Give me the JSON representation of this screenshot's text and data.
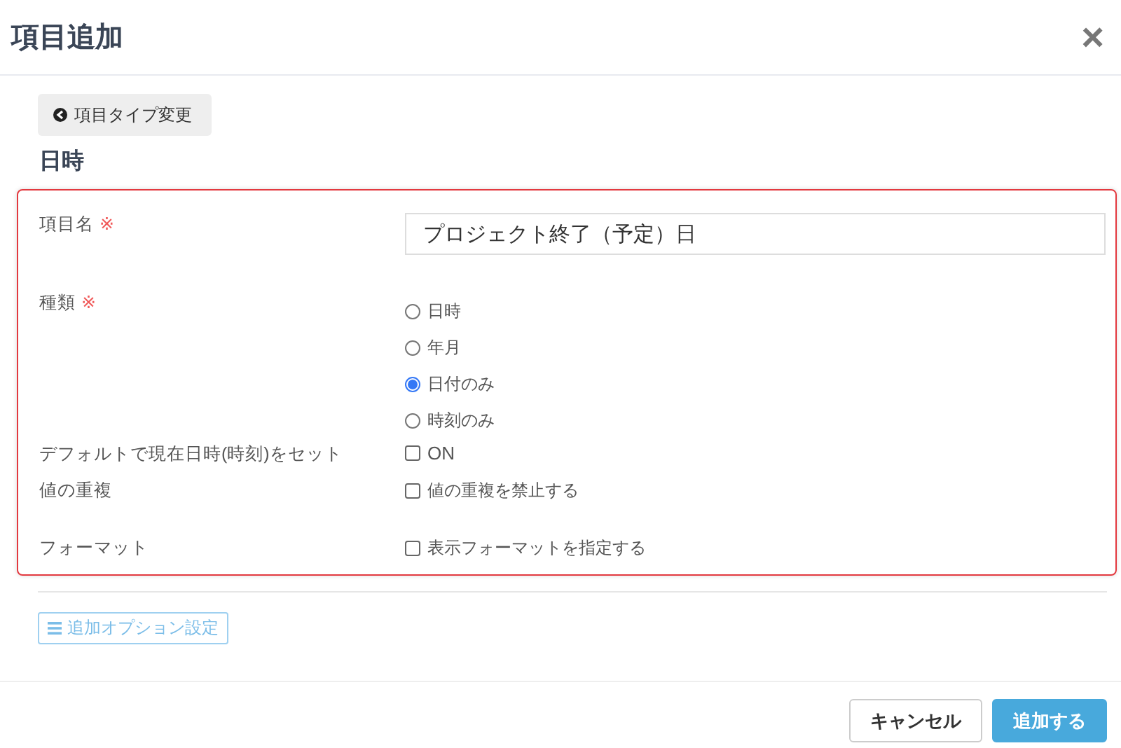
{
  "dialog": {
    "title": "項目追加",
    "close": "×"
  },
  "back_button": {
    "label": "項目タイプ変更"
  },
  "section_title": "日時",
  "fields": [
    {
      "kind": "text",
      "label": "項目名",
      "required_mark": "※",
      "value": "プロジェクト終了（予定）日"
    },
    {
      "kind": "radio",
      "label": "種類",
      "required_mark": "※",
      "options": [
        {
          "label": "日時",
          "selected": false
        },
        {
          "label": "年月",
          "selected": false
        },
        {
          "label": "日付のみ",
          "selected": true
        },
        {
          "label": "時刻のみ",
          "selected": false
        }
      ]
    },
    {
      "kind": "checkbox",
      "label": "デフォルトで現在日時(時刻)をセット",
      "option": {
        "label": "ON",
        "checked": false
      }
    },
    {
      "kind": "checkbox",
      "label": "値の重複",
      "option": {
        "label": "値の重複を禁止する",
        "checked": false
      }
    },
    {
      "kind": "checkbox",
      "label": "フォーマット",
      "option": {
        "label": "表示フォーマットを指定する",
        "checked": false
      }
    }
  ],
  "options_button": {
    "label": "追加オプション設定"
  },
  "footer_buttons": [
    {
      "kind": "secondary",
      "label": "キャンセル"
    },
    {
      "kind": "primary",
      "label": "追加する"
    }
  ]
}
